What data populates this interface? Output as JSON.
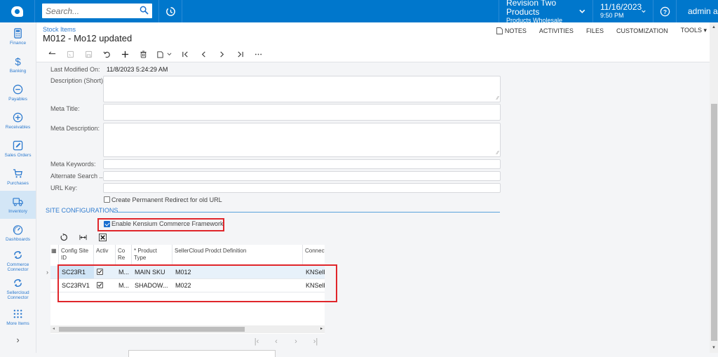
{
  "topbar": {
    "search_placeholder": "Search...",
    "company": {
      "name": "Revision Two Products",
      "branch": "Products Wholesale"
    },
    "datetime": {
      "date": "11/16/2023",
      "time": "9:50 PM"
    },
    "user": "admin a"
  },
  "sidebar": {
    "items": [
      {
        "label": "Finance",
        "icon": "calculator-icon"
      },
      {
        "label": "Banking",
        "icon": "dollar-icon"
      },
      {
        "label": "Payables",
        "icon": "minus-circle-icon"
      },
      {
        "label": "Receivables",
        "icon": "plus-circle-icon"
      },
      {
        "label": "Sales Orders",
        "icon": "edit-icon"
      },
      {
        "label": "Purchases",
        "icon": "cart-icon"
      },
      {
        "label": "Inventory",
        "icon": "truck-icon",
        "active": true
      },
      {
        "label": "Dashboards",
        "icon": "gauge-icon"
      },
      {
        "label": "Commerce Connector",
        "icon": "sync-icon"
      },
      {
        "label": "Sellercloud Connector",
        "icon": "sync-icon"
      },
      {
        "label": "More Items",
        "icon": "grid-icon"
      }
    ],
    "expand": "›"
  },
  "header": {
    "breadcrumb": "Stock Items",
    "title": "M012 - Mo12 updated",
    "actions": [
      "NOTES",
      "ACTIVITIES",
      "FILES",
      "CUSTOMIZATION",
      "TOOLS ▾"
    ]
  },
  "toolbar": {
    "buttons": [
      "back",
      "save-close",
      "save",
      "undo",
      "add",
      "delete",
      "copy-paste",
      "first",
      "previous",
      "next",
      "last",
      "more"
    ]
  },
  "form": {
    "last_modified_label": "Last Modified On:",
    "last_modified_value": "11/8/2023 5:24:29 AM",
    "description_short_label": "Description (Short):",
    "description_short_value": "",
    "meta_title_label": "Meta Title:",
    "meta_title_value": "",
    "meta_description_label": "Meta Description:",
    "meta_description_value": "",
    "meta_keywords_label": "Meta Keywords:",
    "meta_keywords_value": "",
    "alternate_search_label": "Alternate Search ...",
    "alternate_search_value": "",
    "url_key_label": "URL Key:",
    "url_key_value": "",
    "permanent_redirect_label": "Create Permanent Redirect for old URL",
    "permanent_redirect_checked": false
  },
  "site_config": {
    "section_title": "SITE CONFIGURATIONS",
    "enable_label": "Enable Kensium Commerce Framework",
    "enable_checked": true,
    "grid": {
      "columns": [
        "Config Site ID",
        "Activ",
        "Co Re",
        "* Product Type",
        "SellerCloud Prodct Definition",
        "Connect"
      ],
      "rows": [
        {
          "config_site_id": "SC23R1",
          "active": true,
          "co_re": "M...",
          "product_type": "MAIN SKU",
          "definition": "M012",
          "connector": "KNSelle"
        },
        {
          "config_site_id": "SC23RV1",
          "active": true,
          "co_re": "M...",
          "product_type": "SHADOW...",
          "definition": "M022",
          "connector": "KNSelle"
        }
      ]
    }
  }
}
